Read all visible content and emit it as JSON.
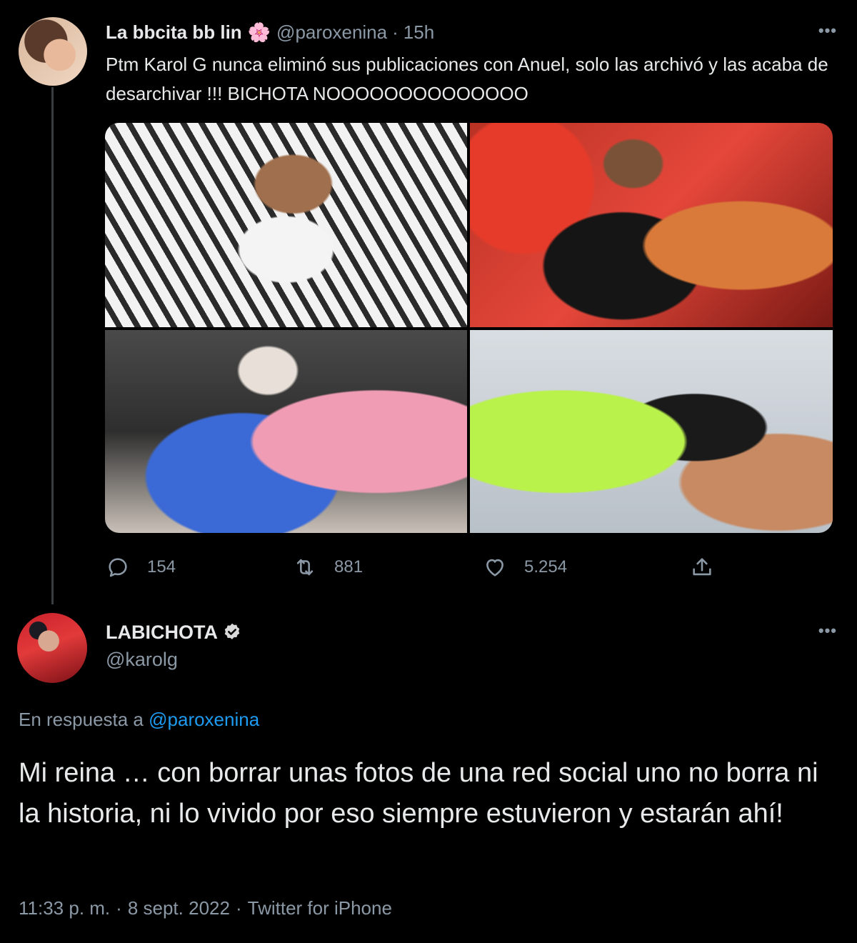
{
  "tweet1": {
    "display_name": "La bbcita bb lin",
    "name_emoji": "🌸",
    "handle": "@paroxenina",
    "separator": "·",
    "time": "15h",
    "more": "•••",
    "text": "Ptm Karol G nunca eliminó sus publicaciones con Anuel, solo las archivó y las acaba de desarchivar !!! BICHOTA NOOOOOOOOOOOOOO",
    "stats": {
      "replies": "154",
      "retweets": "881",
      "likes": "5.254"
    }
  },
  "tweet2": {
    "display_name": "LABICHOTA",
    "handle": "@karolg",
    "more": "•••",
    "reply_prefix": "En respuesta a ",
    "reply_mention": "@paroxenina",
    "text": "Mi reina … con borrar unas fotos de una red social uno no borra ni la historia, ni lo vivido por eso siempre estuvieron y estarán ahí!",
    "time": "11:33 p. m.",
    "date": "8 sept. 2022",
    "source": "Twitter for iPhone",
    "separator": "·"
  },
  "colors": {
    "background": "#000000",
    "text": "#e7e9ea",
    "secondary": "#8b98a5",
    "link": "#1d9bf0"
  },
  "icons": {
    "reply": "reply-icon",
    "retweet": "retweet-icon",
    "like": "heart-icon",
    "share": "share-icon",
    "verified": "verified-badge-icon",
    "more": "more-options-icon"
  }
}
